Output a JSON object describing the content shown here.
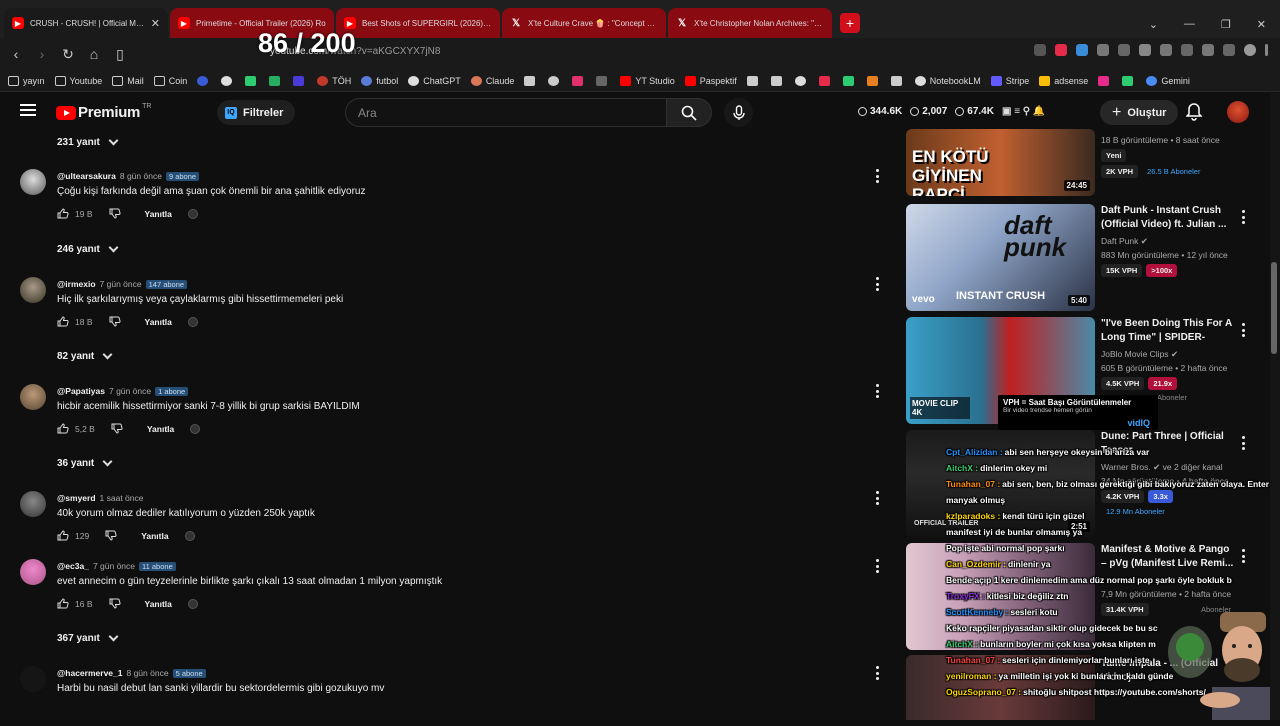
{
  "browser": {
    "tabs": [
      {
        "title": "CRUSH - CRUSH! | Official Music",
        "icon": "youtube-icon",
        "active": true
      },
      {
        "title": "Primetime - Official Trailer (2026) Ro",
        "icon": "youtube-icon"
      },
      {
        "title": "Best Shots of SUPERGIRL (2026) - Yo",
        "icon": "youtube-icon"
      },
      {
        "title": "X'te Culture Crave 🍿 : \"Concept art f",
        "icon": "x-icon"
      },
      {
        "title": "X'te Christopher Nolan Archives: \"Ch",
        "icon": "x-icon"
      }
    ],
    "url_host": "youtube.com",
    "url_path": "/watch?v=aKGCXYX7jN8",
    "overlay_counter": "86 / 200",
    "bookmarks": [
      "yayın",
      "Youtube",
      "Mail",
      "Coin",
      "TÖH",
      "futbol",
      "ChatGPT",
      "Claude",
      "YT Studio",
      "Paspektif",
      "NotebookLM",
      "Stripe",
      "adsense",
      "Gemini"
    ]
  },
  "youtube": {
    "logo_text": "Premium",
    "region": "TR",
    "filters_label": "Filtreler",
    "search_placeholder": "Ara",
    "stats": {
      "subs": "344.6K",
      "videos": "2,007",
      "views": "67.4K"
    },
    "create_label": "Oluştur"
  },
  "comments": {
    "reply_toggles": [
      "231 yanıt",
      "246 yanıt",
      "82 yanıt",
      "36 yanıt",
      "367 yanıt"
    ],
    "items": [
      {
        "user": "@ultearsakura",
        "time": "8 gün önce",
        "badge": "9 abone",
        "text": "Çoğu kişi farkında değil ama şuan çok önemli bir ana şahitlik ediyoruz",
        "likes": "19 B",
        "reply": "Yanıtla"
      },
      {
        "user": "@irmexio",
        "time": "7 gün önce",
        "badge": "147 abone",
        "text": "Hiç ilk şarkılarıymış veya çaylaklarmış gibi hissettirmemeleri peki",
        "likes": "18 B",
        "reply": "Yanıtla"
      },
      {
        "user": "@Papatiyas",
        "time": "7 gün önce",
        "badge": "1 abone",
        "text": "hicbir acemilik hissettirmiyor sanki 7-8 yillik bi grup sarkisi BAYILDIM",
        "likes": "5,2 B",
        "reply": "Yanıtla"
      },
      {
        "user": "@smyerd",
        "time": "1 saat önce",
        "badge": "",
        "text": "40k yorum olmaz dediler katılıyorum o yüzden 250k yaptık",
        "likes": "129",
        "reply": "Yanıtla"
      },
      {
        "user": "@ec3a_",
        "time": "7 gün önce",
        "badge": "11 abone",
        "text": "evet annecim o gün teyzelerinle birlikte şarkı çıkalı 13 saat olmadan 1 milyon yapmıştık",
        "likes": "16 B",
        "reply": "Yanıtla"
      },
      {
        "user": "@hacermerve_1",
        "time": "8 gün önce",
        "badge": "5 abone",
        "text": "Harbi bu nasil debut lan sanki yillardir bu sektordelermis gibi gozukuyo mv",
        "likes": "",
        "reply": ""
      }
    ]
  },
  "sidebar_videos": [
    {
      "title": "",
      "thumb_text": "EN KÖTÜ GİYİNEN RAPÇİ",
      "duration": "24:45",
      "channel": "",
      "views": "18 B görüntüleme • 8 saat önce",
      "new_badge": "Yeni",
      "vph": "2K VPH",
      "outlier": "",
      "subs": "26.5 B Aboneler"
    },
    {
      "title": "Daft Punk - Instant Crush (Official Video) ft. Julian ...",
      "thumb_text": "INSTANT CRUSH",
      "duration": "5:40",
      "channel": "Daft Punk",
      "views": "883 Mn görüntüleme • 12 yıl önce",
      "new_badge": "",
      "vph": "15K VPH",
      "outlier": ">100x",
      "subs": ""
    },
    {
      "title": "\"I've Been Doing This For A Long Time\" | SPIDER-MAN:...",
      "thumb_text": "MOVIE CLIP 4K",
      "duration": "",
      "channel": "JoBlo Movie Clips",
      "views": "605 B görüntüleme • 2 hafta önce",
      "new_badge": "",
      "vph": "4.5K VPH",
      "outlier": "21.9x",
      "subs": "Aboneler"
    },
    {
      "title": "Dune: Part Three | Official Teaser",
      "thumb_text": "OFFICIAL TRAILER",
      "duration": "2:51",
      "channel": "Warner Bros.",
      "views": "34 Mn görüntüleme • 4 hafta önce",
      "new_badge": "",
      "vph": "4.2K VPH",
      "outlier": "3.3x",
      "subs": "12.9 Mn Aboneler"
    },
    {
      "title": "Manifest & Motive & Pango – pVg (Manifest Live Remi...",
      "thumb_text": "",
      "duration": "",
      "channel": "",
      "views": "7,9 Mn görüntüleme • 2 hafta önce",
      "new_badge": "",
      "vph": "31.4K VPH",
      "outlier": "",
      "subs": "Aboneler"
    },
    {
      "title": "Tame Impala - ... (Official Video)",
      "thumb_text": "",
      "duration": "",
      "channel": "Tame Impala",
      "views": "",
      "new_badge": "",
      "vph": "",
      "outlier": "",
      "subs": ""
    }
  ],
  "tooltip": {
    "title": "VPH = Saat Başı Görüntülenmeler",
    "subtitle": "Bir video trendse hemen görün",
    "brand": "vidIQ"
  },
  "chat": [
    {
      "user": "Cpt_Alizidan",
      "msg": "abi sen herşeye okeysin bi ariza var",
      "color": "#1e90ff"
    },
    {
      "user": "AitchX",
      "msg": "dinlerim okey mi",
      "color": "#3cd070"
    },
    {
      "user": "Tunahan_07",
      "msg": "abi sen, ben, biz olması gerektiği gibi bakıyoruz zaten olaya. Enter",
      "color": "#ff8c00"
    },
    {
      "user": "",
      "msg": "manyak olmuş",
      "color": "#ffffff"
    },
    {
      "user": "kzlparadoks",
      "msg": "kendi türü için güzel",
      "color": "#ffd700"
    },
    {
      "user": "",
      "msg": "manifest iyi de bunlar olmamış ya",
      "color": "#ff4040"
    },
    {
      "user": "",
      "msg": "Pop işte abi normal pop şarkı",
      "color": "#ff4040"
    },
    {
      "user": "Can_Ozdemir",
      "msg": "dinlenir ya",
      "color": "#ffd700"
    },
    {
      "user": "",
      "msg": "Bende açıp 1 kere dinlemedim ama düz normal pop şarkı öyle bokluk b",
      "color": "#ff4040"
    },
    {
      "user": "TroxyFX",
      "msg": "kitlesi biz değiliz ztn",
      "color": "#8a2be2"
    },
    {
      "user": "ScottKenneby",
      "msg": "sesleri kotu",
      "color": "#1e90ff"
    },
    {
      "user": "",
      "msg": "Keko rapçiler piyasadan siktir olup gidecek be bu sc",
      "color": "#ff4040"
    },
    {
      "user": "AitchX",
      "msg": "bunların boyler mi çok kısa yoksa klipten m",
      "color": "#3cd070"
    },
    {
      "user": "Tunahan_07",
      "msg": "sesleri için dinlemiyorlar bunları işte",
      "color": "#ff4040"
    },
    {
      "user": "yenilroman",
      "msg": "ya milletin işi yok ki bunlara mı kaldı günde",
      "color": "#ffd700"
    },
    {
      "user": "OguzSoprano_07",
      "msg": "shitoğlu shitpost https://youtube.com/shorts/",
      "color": "#ffd700"
    }
  ]
}
